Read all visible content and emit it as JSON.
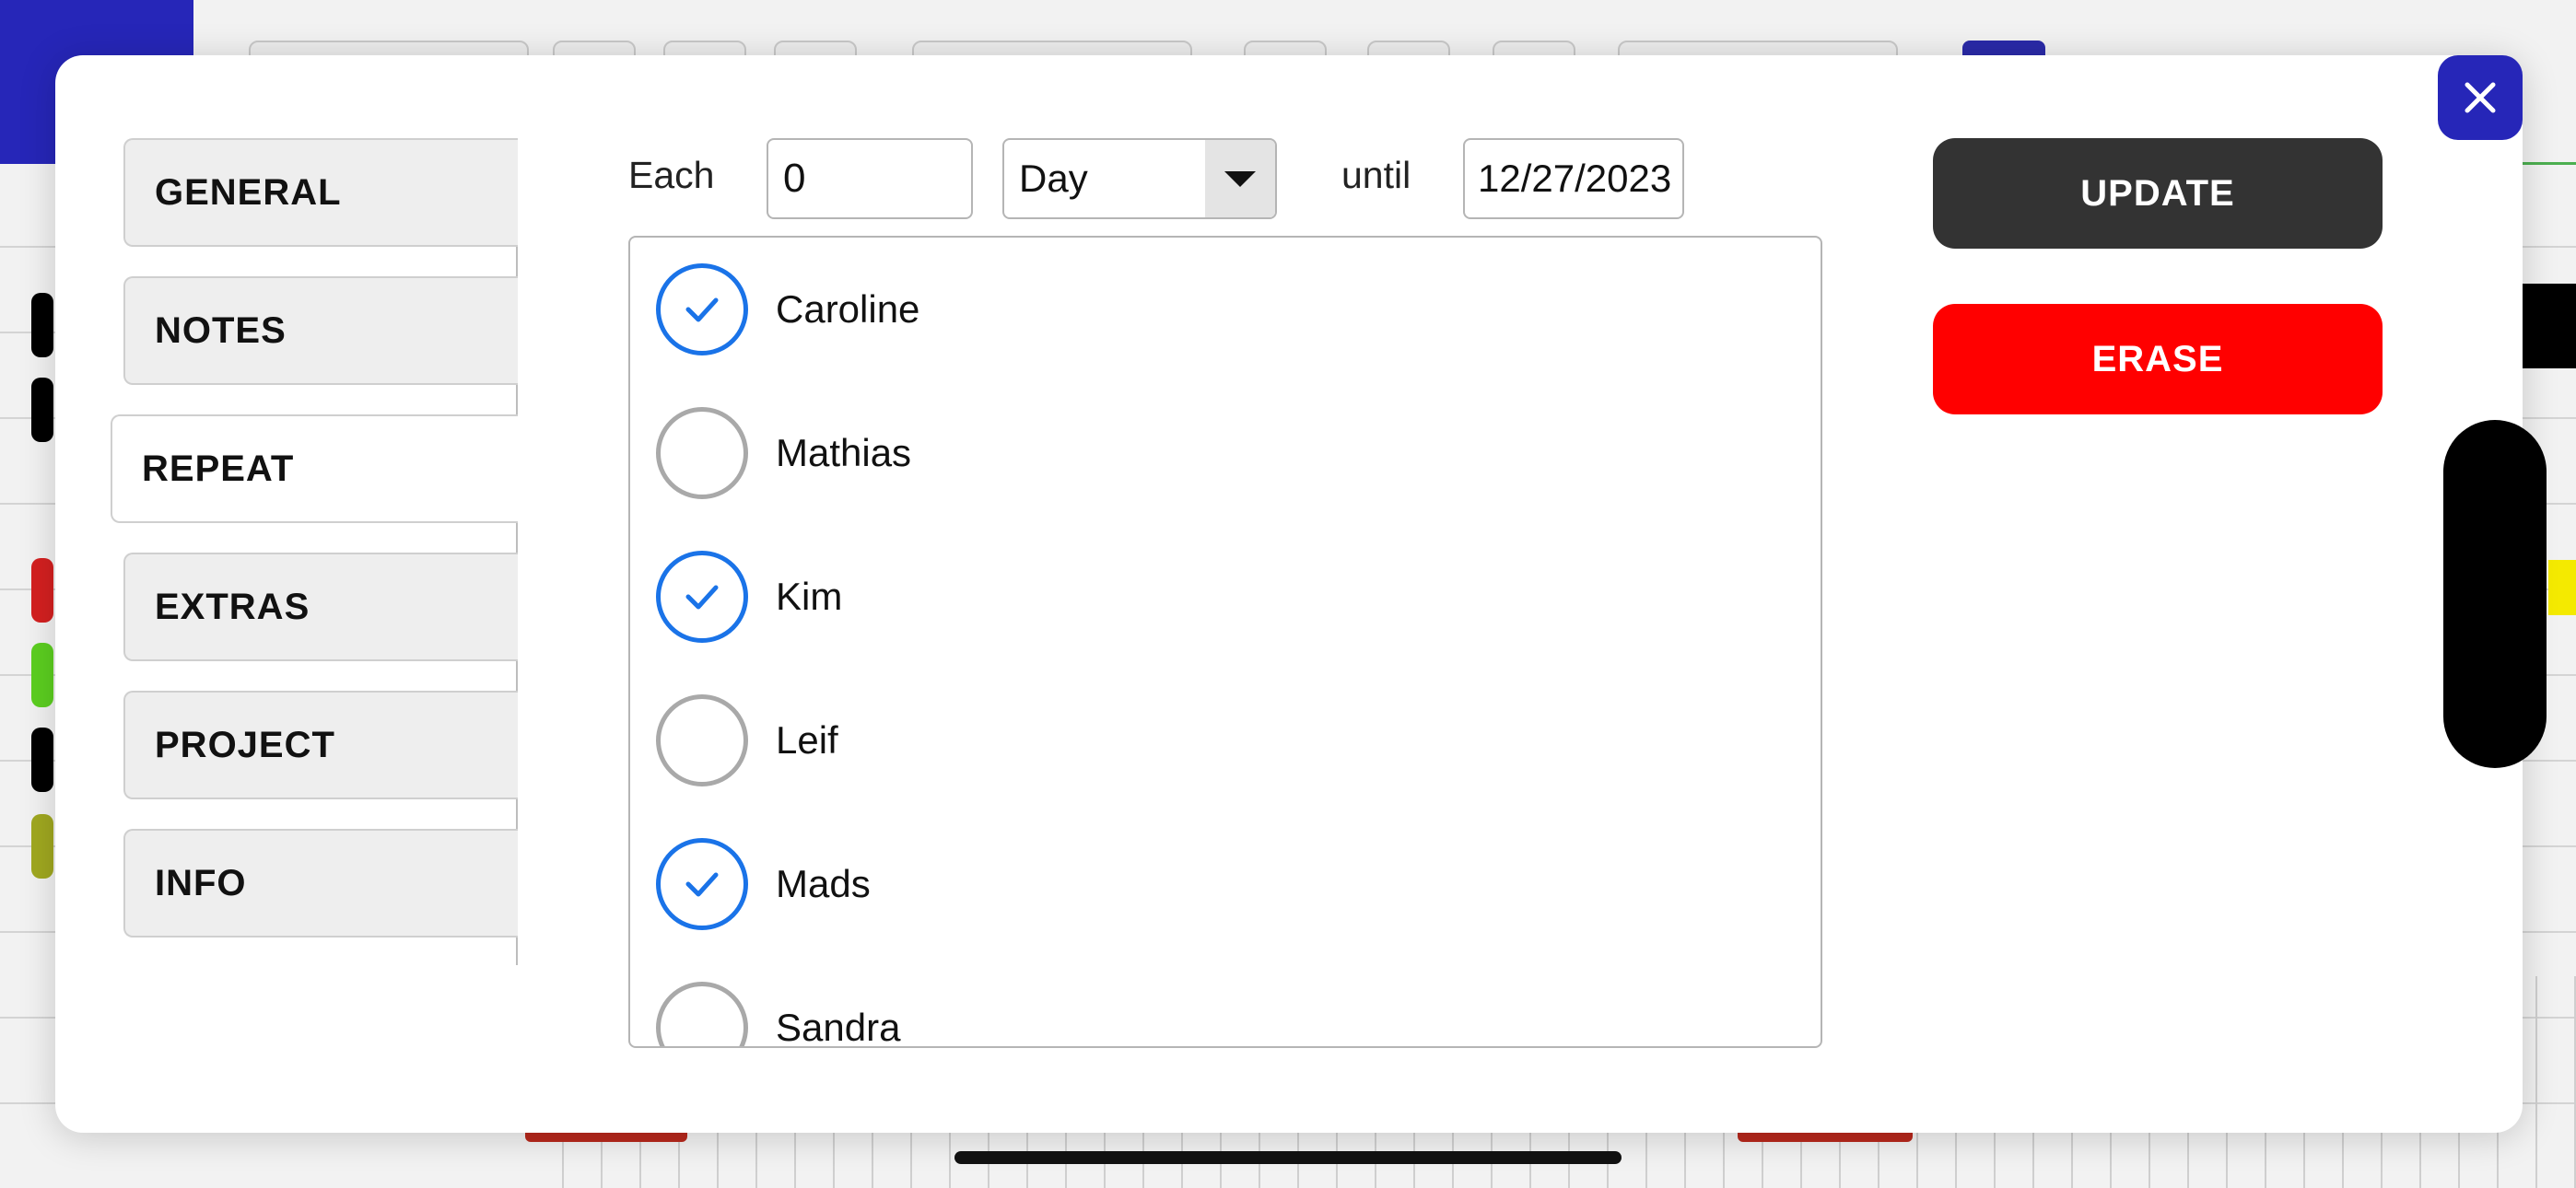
{
  "colors": {
    "accent_blue": "#2626b8",
    "check_blue": "#1a73e8",
    "update_bg": "#333333",
    "erase_bg": "#ff0000"
  },
  "icons": {
    "close": "close-icon",
    "dropdown": "chevron-down-icon",
    "checked": "check-icon"
  },
  "tabs": [
    {
      "label": "GENERAL",
      "active": false
    },
    {
      "label": "NOTES",
      "active": false
    },
    {
      "label": "REPEAT",
      "active": true
    },
    {
      "label": "EXTRAS",
      "active": false
    },
    {
      "label": "PROJECT",
      "active": false
    },
    {
      "label": "INFO",
      "active": false
    }
  ],
  "repeat": {
    "each_label": "Each",
    "each_value": "0",
    "unit_value": "Day",
    "until_label": "until",
    "until_value": "12/27/2023"
  },
  "people": [
    {
      "name": "Caroline",
      "checked": true
    },
    {
      "name": "Mathias",
      "checked": false
    },
    {
      "name": "Kim",
      "checked": true
    },
    {
      "name": "Leif",
      "checked": false
    },
    {
      "name": "Mads",
      "checked": true
    },
    {
      "name": "Sandra",
      "checked": false
    }
  ],
  "actions": {
    "update_label": "UPDATE",
    "erase_label": "ERASE"
  }
}
